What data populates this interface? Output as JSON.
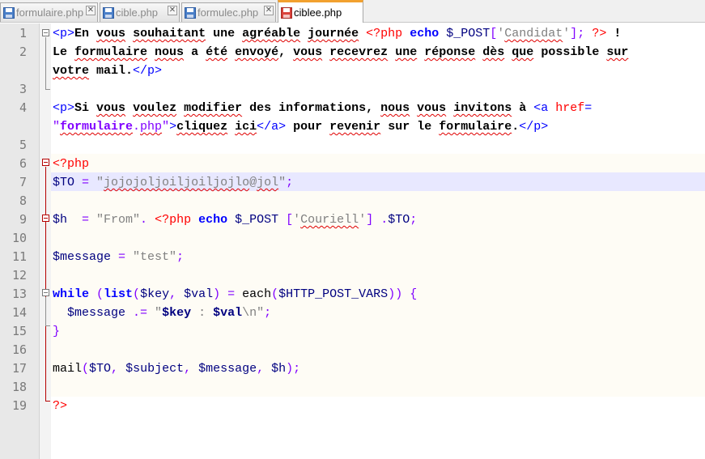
{
  "tabs": [
    {
      "label": "formulaire.php",
      "active": false,
      "icon": "floppy-disk-icon",
      "close": "✕"
    },
    {
      "label": "cible.php",
      "active": false,
      "icon": "floppy-disk-icon",
      "close": "✕"
    },
    {
      "label": "formulec.php",
      "active": false,
      "icon": "floppy-disk-icon",
      "close": "✕"
    },
    {
      "label": "ciblee.php",
      "active": true,
      "icon": "floppy-disk-red-icon"
    }
  ],
  "colors": {
    "accent_tab": "#f2a12f",
    "html_tag": "#0000ff",
    "html_attr": "#ff0000",
    "html_string": "#8000ff",
    "php_delimiter": "#ff0000",
    "php_keyword": "#0000ff",
    "php_variable": "#000080",
    "php_string": "#808080",
    "caret_line": "#e8e8ff",
    "php_block_bg": "#fefcf5"
  },
  "editor": {
    "lines": [
      {
        "num": "1",
        "tokens": [
          {
            "t": "<p>",
            "c": "tag"
          },
          {
            "t": "En ",
            "c": "b"
          },
          {
            "t": "vous",
            "c": "b sq"
          },
          {
            "t": " ",
            "c": "b"
          },
          {
            "t": "souhaitant",
            "c": "b sq"
          },
          {
            "t": " une ",
            "c": "b"
          },
          {
            "t": "agréable",
            "c": "b sq"
          },
          {
            "t": " ",
            "c": "b"
          },
          {
            "t": "journée",
            "c": "b sq"
          },
          {
            "t": " ",
            "c": "b"
          },
          {
            "t": "<?php",
            "c": "phpdel"
          },
          {
            "t": " ",
            "c": ""
          },
          {
            "t": "echo",
            "c": "kw"
          },
          {
            "t": " ",
            "c": ""
          },
          {
            "t": "$_POST",
            "c": "var"
          },
          {
            "t": "[",
            "c": "op"
          },
          {
            "t": "'",
            "c": "phpstr"
          },
          {
            "t": "Candidat",
            "c": "phpstr sq"
          },
          {
            "t": "'",
            "c": "phpstr"
          },
          {
            "t": "];",
            "c": "op"
          },
          {
            "t": " ",
            "c": ""
          },
          {
            "t": "?>",
            "c": "phpdel"
          },
          {
            "t": " !",
            "c": "b"
          }
        ]
      },
      {
        "num": "2",
        "tokens": [
          {
            "t": "Le ",
            "c": "b"
          },
          {
            "t": "formulaire",
            "c": "b sq"
          },
          {
            "t": " ",
            "c": "b"
          },
          {
            "t": "nous",
            "c": "b sq"
          },
          {
            "t": " a ",
            "c": "b"
          },
          {
            "t": "été",
            "c": "b sq"
          },
          {
            "t": " ",
            "c": "b"
          },
          {
            "t": "envoyé",
            "c": "b sq"
          },
          {
            "t": ", ",
            "c": "b"
          },
          {
            "t": "vous",
            "c": "b sq"
          },
          {
            "t": " ",
            "c": "b"
          },
          {
            "t": "recevrez",
            "c": "b sq"
          },
          {
            "t": " ",
            "c": "b"
          },
          {
            "t": "une",
            "c": "b sq"
          },
          {
            "t": " ",
            "c": "b"
          },
          {
            "t": "réponse",
            "c": "b sq"
          },
          {
            "t": " ",
            "c": "b"
          },
          {
            "t": "dès",
            "c": "b sq"
          },
          {
            "t": " ",
            "c": "b"
          },
          {
            "t": "que",
            "c": "b sq"
          },
          {
            "t": " possible ",
            "c": "b"
          },
          {
            "t": "sur",
            "c": "b sq"
          }
        ]
      },
      {
        "num": "",
        "tokens": [
          {
            "t": "votre",
            "c": "b sq"
          },
          {
            "t": " mail.",
            "c": "b"
          },
          {
            "t": "</p>",
            "c": "tag"
          }
        ]
      },
      {
        "num": "3",
        "tokens": []
      },
      {
        "num": "4",
        "tokens": [
          {
            "t": "<p>",
            "c": "tag"
          },
          {
            "t": "Si ",
            "c": "b"
          },
          {
            "t": "vous",
            "c": "b sq"
          },
          {
            "t": " ",
            "c": "b"
          },
          {
            "t": "voulez",
            "c": "b sq"
          },
          {
            "t": " ",
            "c": "b"
          },
          {
            "t": "modifier",
            "c": "b sq"
          },
          {
            "t": " des informations, ",
            "c": "b"
          },
          {
            "t": "nous",
            "c": "b sq"
          },
          {
            "t": " ",
            "c": "b"
          },
          {
            "t": "vous",
            "c": "b sq"
          },
          {
            "t": " ",
            "c": "b"
          },
          {
            "t": "invitons",
            "c": "b sq"
          },
          {
            "t": " à ",
            "c": "b"
          },
          {
            "t": "<a",
            "c": "tag"
          },
          {
            "t": " ",
            "c": ""
          },
          {
            "t": "href",
            "c": "attr"
          },
          {
            "t": "=",
            "c": "tag"
          }
        ]
      },
      {
        "num": "",
        "tokens": [
          {
            "t": "\"",
            "c": "str"
          },
          {
            "t": "formulaire",
            "c": "str b sq"
          },
          {
            "t": ".",
            "c": "str"
          },
          {
            "t": "php",
            "c": "str sq"
          },
          {
            "t": "\"",
            "c": "str"
          },
          {
            "t": ">",
            "c": "tag"
          },
          {
            "t": "cliquez",
            "c": "b sq"
          },
          {
            "t": " ",
            "c": "b"
          },
          {
            "t": "ici",
            "c": "b sq"
          },
          {
            "t": "</a>",
            "c": "tag"
          },
          {
            "t": " pour ",
            "c": "b"
          },
          {
            "t": "revenir",
            "c": "b sq"
          },
          {
            "t": " sur le ",
            "c": "b"
          },
          {
            "t": "formulaire",
            "c": "b sq"
          },
          {
            "t": ".",
            "c": "b"
          },
          {
            "t": "</p>",
            "c": "tag"
          }
        ]
      },
      {
        "num": "5",
        "tokens": []
      },
      {
        "num": "6",
        "tokens": [
          {
            "t": "<?php",
            "c": "phpdel"
          }
        ]
      },
      {
        "num": "7",
        "tokens": [
          {
            "t": "$TO",
            "c": "var"
          },
          {
            "t": " = ",
            "c": "op"
          },
          {
            "t": "\"",
            "c": "phpstr"
          },
          {
            "t": "jojojoljoiljoiljojlo",
            "c": "phpstr sq"
          },
          {
            "t": "@",
            "c": "phpstr"
          },
          {
            "t": "jol",
            "c": "phpstr sq"
          },
          {
            "t": "\"",
            "c": "phpstr"
          },
          {
            "t": ";",
            "c": "op"
          }
        ]
      },
      {
        "num": "8",
        "tokens": []
      },
      {
        "num": "9",
        "tokens": [
          {
            "t": "$h",
            "c": "var"
          },
          {
            "t": "  = ",
            "c": "op"
          },
          {
            "t": "\"From\"",
            "c": "phpstr"
          },
          {
            "t": ". ",
            "c": "op"
          },
          {
            "t": "<?php",
            "c": "phpdel"
          },
          {
            "t": " ",
            "c": ""
          },
          {
            "t": "echo",
            "c": "kw"
          },
          {
            "t": " ",
            "c": ""
          },
          {
            "t": "$_POST",
            "c": "var"
          },
          {
            "t": " [",
            "c": "op"
          },
          {
            "t": "'",
            "c": "phpstr"
          },
          {
            "t": "Couriell",
            "c": "phpstr sq"
          },
          {
            "t": "'",
            "c": "phpstr"
          },
          {
            "t": "] .",
            "c": "op"
          },
          {
            "t": "$TO",
            "c": "var"
          },
          {
            "t": ";",
            "c": "op"
          }
        ]
      },
      {
        "num": "10",
        "tokens": []
      },
      {
        "num": "11",
        "tokens": [
          {
            "t": "$message",
            "c": "var"
          },
          {
            "t": " = ",
            "c": "op"
          },
          {
            "t": "\"test\"",
            "c": "phpstr"
          },
          {
            "t": ";",
            "c": "op"
          }
        ]
      },
      {
        "num": "12",
        "tokens": []
      },
      {
        "num": "13",
        "tokens": [
          {
            "t": "while",
            "c": "kw"
          },
          {
            "t": " (",
            "c": "op"
          },
          {
            "t": "list",
            "c": "kw"
          },
          {
            "t": "(",
            "c": "op"
          },
          {
            "t": "$key",
            "c": "var"
          },
          {
            "t": ", ",
            "c": "op"
          },
          {
            "t": "$val",
            "c": "var"
          },
          {
            "t": ") = ",
            "c": "op"
          },
          {
            "t": "each",
            "c": ""
          },
          {
            "t": "(",
            "c": "op"
          },
          {
            "t": "$HTTP_POST_VARS",
            "c": "var"
          },
          {
            "t": ")) {",
            "c": "op"
          }
        ]
      },
      {
        "num": "14",
        "tokens": [
          {
            "t": "  ",
            "c": ""
          },
          {
            "t": "$message",
            "c": "var"
          },
          {
            "t": " .= ",
            "c": "op"
          },
          {
            "t": "\"",
            "c": "phpstr"
          },
          {
            "t": "$key",
            "c": "var b"
          },
          {
            "t": " : ",
            "c": "phpstr"
          },
          {
            "t": "$val",
            "c": "var b"
          },
          {
            "t": "\\n\"",
            "c": "phpstr"
          },
          {
            "t": ";",
            "c": "op"
          }
        ]
      },
      {
        "num": "15",
        "tokens": [
          {
            "t": "}",
            "c": "op"
          }
        ]
      },
      {
        "num": "16",
        "tokens": []
      },
      {
        "num": "17",
        "tokens": [
          {
            "t": "mail",
            "c": ""
          },
          {
            "t": "(",
            "c": "op"
          },
          {
            "t": "$TO",
            "c": "var"
          },
          {
            "t": ", ",
            "c": "op"
          },
          {
            "t": "$subject",
            "c": "var"
          },
          {
            "t": ", ",
            "c": "op"
          },
          {
            "t": "$message",
            "c": "var"
          },
          {
            "t": ", ",
            "c": "op"
          },
          {
            "t": "$h",
            "c": "var"
          },
          {
            "t": ");",
            "c": "op"
          }
        ]
      },
      {
        "num": "18",
        "tokens": []
      },
      {
        "num": "19",
        "tokens": [
          {
            "t": "?>",
            "c": "phpdel"
          }
        ]
      }
    ]
  }
}
